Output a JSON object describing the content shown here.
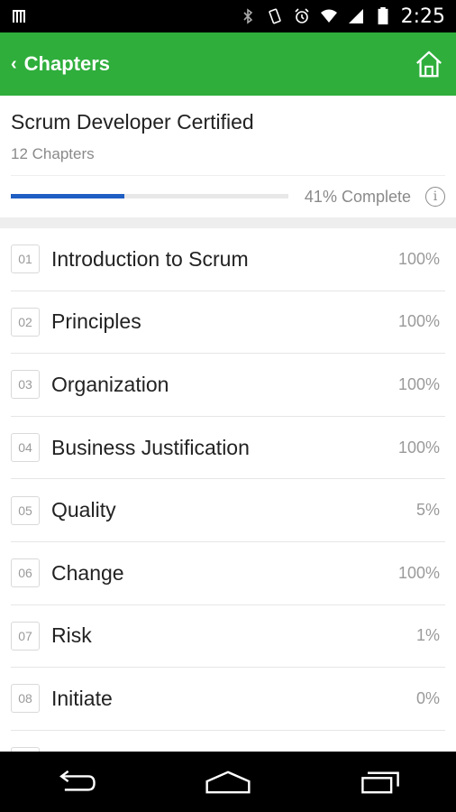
{
  "status_bar": {
    "time": "2:25",
    "icons": [
      "barcode-icon",
      "bluetooth-icon",
      "vibrate-icon",
      "alarm-icon",
      "wifi-icon",
      "signal-icon",
      "battery-icon"
    ]
  },
  "app_bar": {
    "back_chevron": "‹",
    "title": "Chapters",
    "home_icon": "home-icon",
    "color": "#2fae3c"
  },
  "course": {
    "title": "Scrum Developer Certified",
    "subtitle": "12 Chapters",
    "progress_text": "41% Complete",
    "progress_fraction": 0.41,
    "progress_color": "#1f5ec3",
    "info_label": "i"
  },
  "chapters": [
    {
      "num": "01",
      "title": "Introduction to Scrum",
      "pct": "100%"
    },
    {
      "num": "02",
      "title": "Principles",
      "pct": "100%"
    },
    {
      "num": "03",
      "title": "Organization",
      "pct": "100%"
    },
    {
      "num": "04",
      "title": "Business Justification",
      "pct": "100%"
    },
    {
      "num": "05",
      "title": "Quality",
      "pct": "5%"
    },
    {
      "num": "06",
      "title": "Change",
      "pct": "100%"
    },
    {
      "num": "07",
      "title": "Risk",
      "pct": "1%"
    },
    {
      "num": "08",
      "title": "Initiate",
      "pct": "0%"
    },
    {
      "num": "",
      "title": "",
      "pct": ""
    }
  ],
  "nav_bar": {
    "icons": [
      "back-icon",
      "home-nav-icon",
      "recents-icon"
    ]
  }
}
